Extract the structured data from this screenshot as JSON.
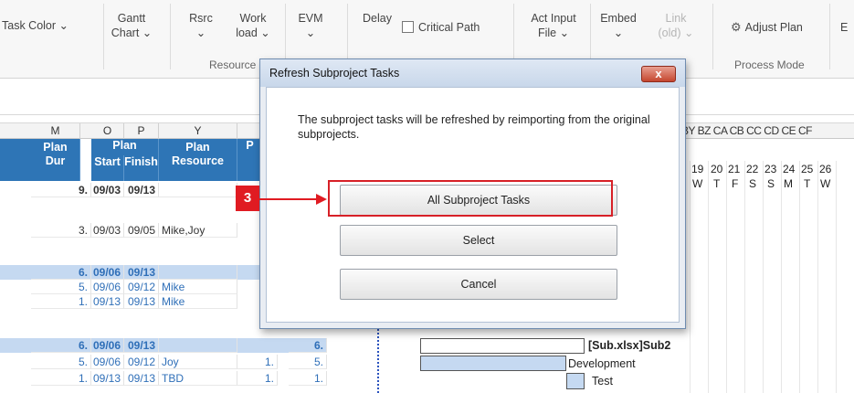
{
  "ribbon": {
    "task_color": "Task Color ⌄",
    "gantt_1": "Gantt",
    "gantt_2": "Chart ⌄",
    "rsrc_1": "Rsrc",
    "rsrc_2": "⌄",
    "work_1": "Work",
    "work_2": "load ⌄",
    "evm_1": "EVM",
    "evm_2": "⌄",
    "delay": "Delay",
    "critical_path": "Critical Path",
    "act_input_1": "Act Input",
    "act_input_2": "File ⌄",
    "embed_1": "Embed",
    "embed_2": "⌄",
    "link_1": "Link",
    "link_2": "(old) ⌄",
    "adjust_plan": "Adjust Plan",
    "edge": "E",
    "group_resource": "Resource",
    "group_process_mode": "Process Mode"
  },
  "sheet": {
    "col_letters": [
      "M",
      "O",
      "P",
      "Y"
    ],
    "gantt_col_letters": "BY BZ CA CB CC CD CE CF",
    "header": {
      "plan_dur_1": "Plan",
      "plan_dur_2": "Dur",
      "plan": "Plan",
      "start": "Start",
      "finish": "Finish",
      "plan_res_1": "Plan",
      "plan_res_2": "Resource",
      "p_cut": "P"
    },
    "day_numbers": [
      "19",
      "20",
      "21",
      "22",
      "23",
      "24",
      "25",
      "26"
    ],
    "day_letters": [
      "W",
      "T",
      "F",
      "S",
      "S",
      "M",
      "T",
      "W"
    ],
    "rows": [
      {
        "dur": "9.",
        "start": "09/03",
        "finish": "09/13",
        "res": "",
        "bold": true
      },
      {
        "dur": "3.",
        "start": "09/03",
        "finish": "09/05",
        "res": "Mike,Joy"
      },
      {
        "dur": "6.",
        "start": "09/06",
        "finish": "09/13",
        "res": ""
      },
      {
        "dur": "5.",
        "start": "09/06",
        "finish": "09/12",
        "res": "Mike"
      },
      {
        "dur": "1.",
        "start": "09/13",
        "finish": "09/13",
        "res": "Mike"
      },
      {
        "dur": "6.",
        "start": "09/06",
        "finish": "09/13",
        "res": "",
        "extra": "6."
      },
      {
        "dur": "5.",
        "start": "09/06",
        "finish": "09/12",
        "res": "Joy",
        "n1": "1.",
        "extra": "5."
      },
      {
        "dur": "1.",
        "start": "09/13",
        "finish": "09/13",
        "res": "TBD",
        "n1": "1.",
        "extra": "1."
      }
    ],
    "gantt_labels": {
      "sub2": "[Sub.xlsx]Sub2",
      "development": "Development",
      "test": "Test"
    }
  },
  "dialog": {
    "title": "Refresh Subproject Tasks",
    "close": "x",
    "message": "The subproject tasks will be refreshed by reimporting from the original subprojects.",
    "btn_all": "All Subproject Tasks",
    "btn_select": "Select",
    "btn_cancel": "Cancel"
  },
  "callout": {
    "number": "3",
    "color": "#e01b22"
  },
  "colors": {
    "header_blue": "#2e75b6",
    "band_blue": "#c5d9f1",
    "text_blue": "#2f6fb8"
  }
}
